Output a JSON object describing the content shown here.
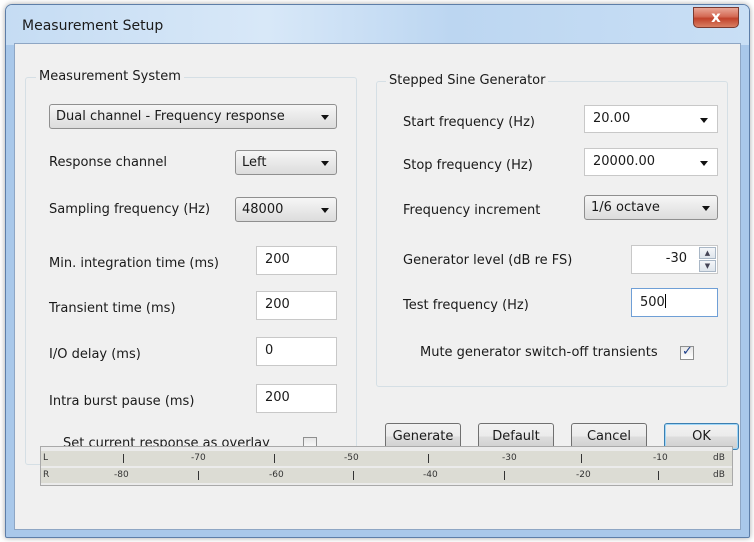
{
  "window": {
    "title": "Measurement Setup",
    "close_glyph": "x"
  },
  "measurement_system": {
    "group_title": "Measurement System",
    "mode": "Dual channel - Frequency response",
    "response_channel_label": "Response channel",
    "response_channel": "Left",
    "sampling_label": "Sampling frequency (Hz)",
    "sampling": "48000",
    "min_integration_label": "Min. integration time (ms)",
    "min_integration": "200",
    "transient_label": "Transient time (ms)",
    "transient": "200",
    "io_delay_label": "I/O delay (ms)",
    "io_delay": "0",
    "intra_burst_label": "Intra burst pause (ms)",
    "intra_burst": "200",
    "overlay_label": "Set current response as overlay",
    "overlay_checked": false
  },
  "stepped_sine": {
    "group_title": "Stepped Sine Generator",
    "start_label": "Start frequency (Hz)",
    "start": "20.00",
    "stop_label": "Stop frequency (Hz)",
    "stop": "20000.00",
    "increment_label": "Frequency increment",
    "increment": "1/6 octave",
    "level_label": "Generator level (dB re FS)",
    "level": "-30",
    "test_freq_label": "Test frequency (Hz)",
    "test_freq": "500",
    "mute_label": "Mute generator switch-off transients",
    "mute_checked": true
  },
  "buttons": {
    "generate": "Generate",
    "default": "Default",
    "cancel": "Cancel",
    "ok": "OK"
  },
  "level_meter": {
    "row_l": {
      "channel": "L",
      "labels": [
        "-70",
        "-50",
        "-30",
        "-10"
      ],
      "unit": "dB"
    },
    "row_r": {
      "channel": "R",
      "labels": [
        "-80",
        "-60",
        "-40",
        "-20"
      ],
      "unit": "dB"
    }
  },
  "colors": {
    "dialog_bg": "#f0f0f0",
    "titlebar": "#c5dcf3",
    "close_button": "#c1422b",
    "checkmark": "#1d3f8a",
    "default_button_border": "#3c7fb1"
  }
}
